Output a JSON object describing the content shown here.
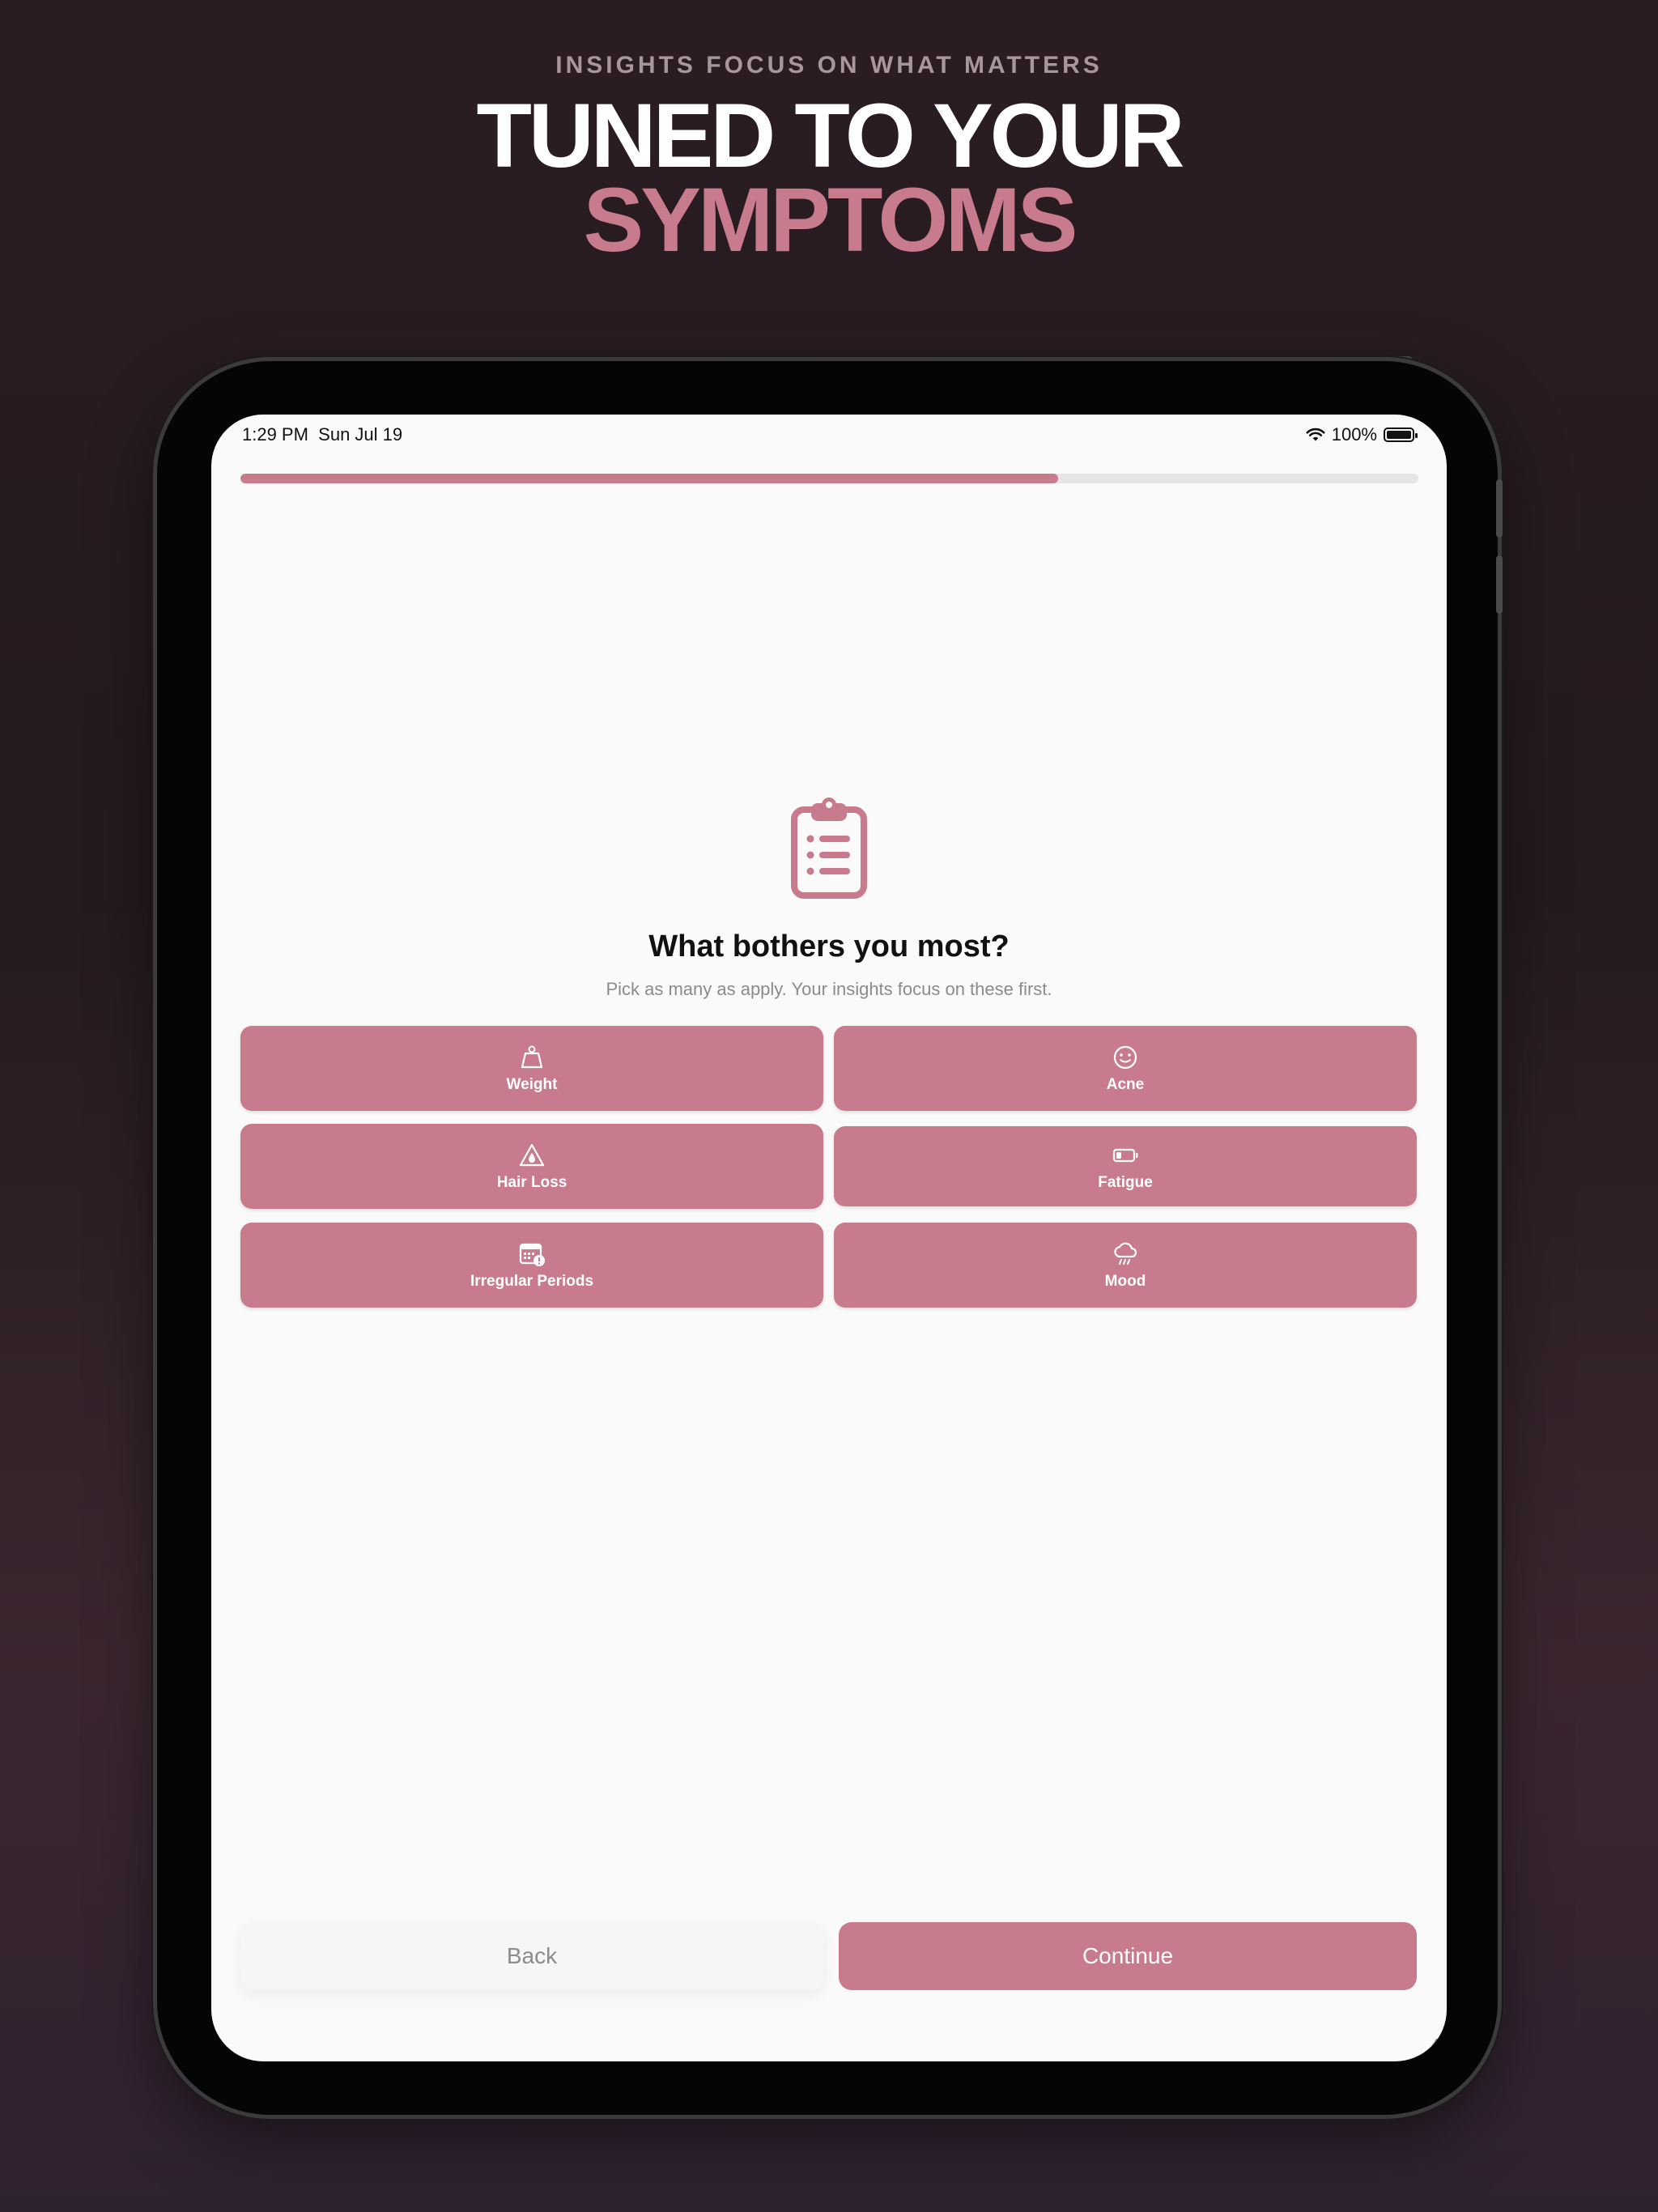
{
  "promo": {
    "eyebrow": "INSIGHTS FOCUS ON WHAT MATTERS",
    "title_line1": "TUNED TO YOUR",
    "title_line2": "SYMPTOMS"
  },
  "status_bar": {
    "time": "1:29 PM",
    "date": "Sun Jul 19",
    "battery": "100%"
  },
  "progress": {
    "fraction": 0.694
  },
  "question": {
    "icon": "clipboard-list-icon",
    "title": "What bothers you most?",
    "subtitle": "Pick as many as apply. Your insights focus on these first."
  },
  "options": [
    {
      "label": "Weight",
      "icon": "scale-weight-icon"
    },
    {
      "label": "Acne",
      "icon": "face-icon"
    },
    {
      "label": "Hair Loss",
      "icon": "warning-drop-icon"
    },
    {
      "label": "Fatigue",
      "icon": "low-battery-icon"
    },
    {
      "label": "Irregular Periods",
      "icon": "calendar-alert-icon"
    },
    {
      "label": "Mood",
      "icon": "cloud-rain-icon"
    }
  ],
  "nav": {
    "back_label": "Back",
    "continue_label": "Continue"
  },
  "colors": {
    "accent": "#c97b8e",
    "background": "#fbfafa",
    "text": "#111111",
    "muted": "#8d8a8c"
  }
}
